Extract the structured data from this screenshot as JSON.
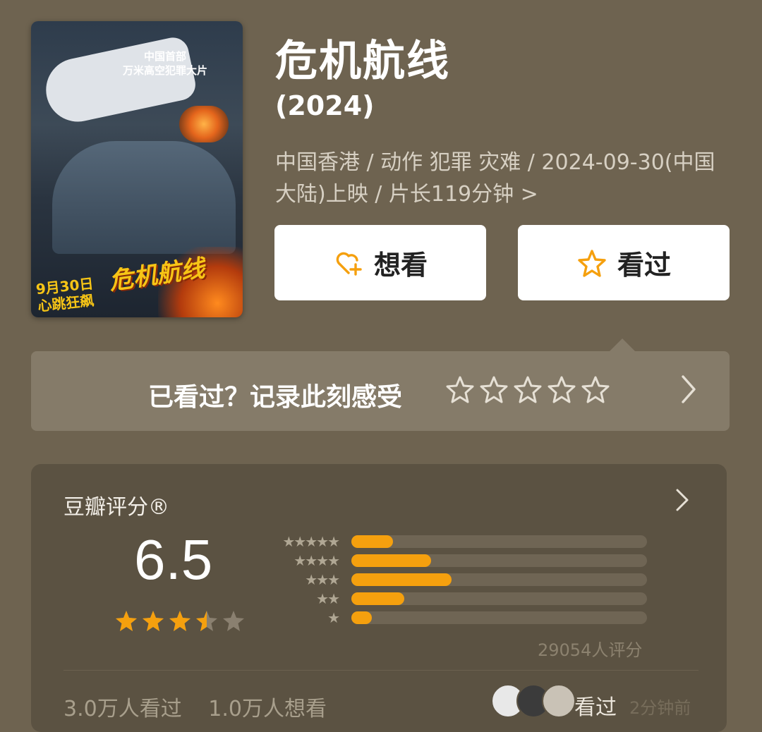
{
  "poster": {
    "tagline": [
      "中国首部",
      "万米高空犯罪大片"
    ],
    "title": "危机航线",
    "release_line": [
      "9月30日",
      "心跳狂飙"
    ]
  },
  "movie": {
    "title": "危机航线",
    "year": "(2024)",
    "meta": "中国香港 / 动作 犯罪 灾难 / 2024-09-30(中国大陆)上映 / 片长119分钟 >"
  },
  "buttons": {
    "want": "想看",
    "seen": "看过"
  },
  "rate_prompt": {
    "text": "已看过？记录此刻感受"
  },
  "rating": {
    "label": "豆瓣评分®",
    "score": "6.5",
    "stars": 3.5,
    "distribution": [
      {
        "stars": "★★★★★",
        "fraction": 0.14
      },
      {
        "stars": "★★★★",
        "fraction": 0.27
      },
      {
        "stars": "★★★",
        "fraction": 0.34
      },
      {
        "stars": "★★",
        "fraction": 0.18
      },
      {
        "stars": "★",
        "fraction": 0.07
      }
    ],
    "count": "29054人评分"
  },
  "footer": {
    "seen_count": "3.0万人看过",
    "want_count": "1.0万人想看",
    "friend_action": "看过",
    "friend_time": "2分钟前"
  },
  "colors": {
    "background": "#6e6350",
    "accent": "#f5a00e",
    "card": "#5b5242"
  },
  "icons": [
    "heart-plus-icon",
    "star-outline-icon",
    "chevron-right-icon"
  ]
}
